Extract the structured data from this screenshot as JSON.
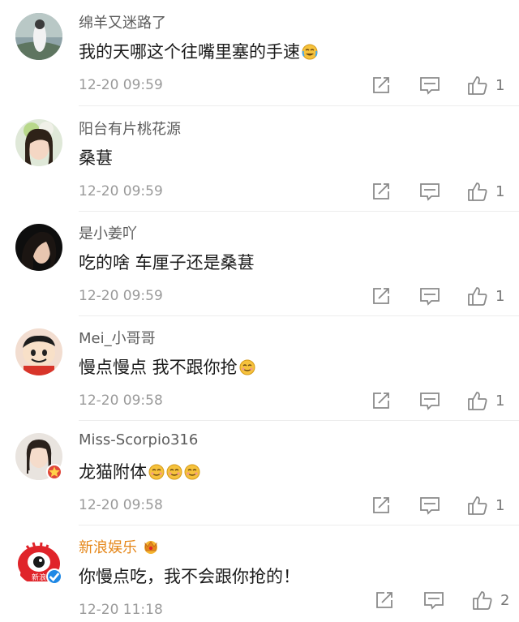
{
  "comments": [
    {
      "username": "绵羊又迷路了",
      "text": "我的天哪这个往嘴里塞的手速",
      "emoji": [
        "laugh-cry-emoji"
      ],
      "time": "12-20 09:59",
      "likes": "1",
      "username_color": "#5c5c5c"
    },
    {
      "username": "阳台有片桃花源",
      "text": "桑葚",
      "emoji": [],
      "time": "12-20 09:59",
      "likes": "1",
      "username_color": "#5c5c5c"
    },
    {
      "username": "是小姜吖",
      "text": "吃的啥 车厘子还是桑葚",
      "emoji": [],
      "time": "12-20 09:59",
      "likes": "1",
      "username_color": "#5c5c5c"
    },
    {
      "username": "Mei_小哥哥",
      "text": "慢点慢点  我不跟你抢",
      "emoji": [
        "smile-emoji"
      ],
      "time": "12-20 09:58",
      "likes": "1",
      "username_color": "#5c5c5c"
    },
    {
      "username": "Miss-Scorpio316",
      "text": "龙猫附体",
      "emoji": [
        "smile-emoji",
        "smile-emoji",
        "smile-emoji"
      ],
      "time": "12-20 09:58",
      "likes": "1",
      "username_color": "#5c5c5c"
    },
    {
      "username": "新浪娱乐",
      "text": "你慢点吃，我不会跟你抢的！",
      "emoji": [],
      "time": "12-20 11:18",
      "likes": "2",
      "username_color": "#e5881c",
      "verified_badge": "crown-vip-icon"
    }
  ],
  "icons": {
    "repost": "repost-icon",
    "comment": "comment-icon",
    "like": "thumb-up-icon"
  },
  "colors": {
    "time": "#9a9a9a",
    "icons": "#8a8a8a",
    "verified_orange": "#e5881c",
    "verified_blue": "#1e88e5"
  }
}
